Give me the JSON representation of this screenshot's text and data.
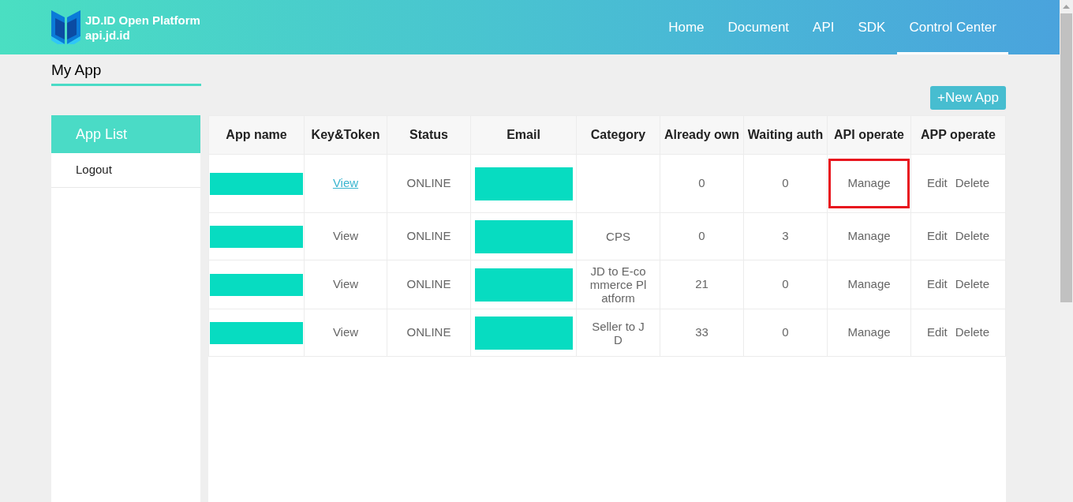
{
  "header": {
    "logo_title": "JD.ID Open Platform",
    "logo_subtitle": "api.jd.id",
    "nav": [
      {
        "label": "Home",
        "selected": false
      },
      {
        "label": "Document",
        "selected": false
      },
      {
        "label": "API",
        "selected": false
      },
      {
        "label": "SDK",
        "selected": false
      },
      {
        "label": "Control Center",
        "selected": true
      }
    ]
  },
  "page_title": "My App",
  "new_app_button": "+New App",
  "sidebar": {
    "items": [
      {
        "label": "App List",
        "selected": true
      },
      {
        "label": "Logout",
        "selected": false
      }
    ]
  },
  "table": {
    "columns": [
      "App name",
      "Key&Token",
      "Status",
      "Email",
      "Category",
      "Already own",
      "Waiting auth",
      "API operate",
      "APP operate"
    ],
    "rows": [
      {
        "name_redacted": true,
        "key_token": {
          "label": "View",
          "hovered": true
        },
        "status": "ONLINE",
        "email_redacted": true,
        "already_own": "0",
        "waiting_auth": "0",
        "api_operate": {
          "label": "Manage",
          "highlighted": true
        },
        "app_operate": [
          "Edit",
          "Delete"
        ]
      },
      {
        "name_redacted": true,
        "key_token": {
          "label": "View",
          "hovered": false
        },
        "status": "ONLINE",
        "email_redacted": true,
        "category": "CPS",
        "already_own": "0",
        "waiting_auth": "3",
        "api_operate": {
          "label": "Manage",
          "highlighted": false
        },
        "app_operate": [
          "Edit",
          "Delete"
        ]
      },
      {
        "name_redacted": true,
        "key_token": {
          "label": "View",
          "hovered": false
        },
        "status": "ONLINE",
        "email_redacted": true,
        "category": "JD to E-commerce Platform",
        "already_own": "21",
        "waiting_auth": "0",
        "api_operate": {
          "label": "Manage",
          "highlighted": false
        },
        "app_operate": [
          "Edit",
          "Delete"
        ]
      },
      {
        "name_redacted": true,
        "key_token": {
          "label": "View",
          "hovered": false
        },
        "status": "ONLINE",
        "email_redacted": true,
        "category": "Seller to JD",
        "already_own": "33",
        "waiting_auth": "0",
        "api_operate": {
          "label": "Manage",
          "highlighted": false
        },
        "app_operate": [
          "Edit",
          "Delete"
        ]
      }
    ]
  }
}
